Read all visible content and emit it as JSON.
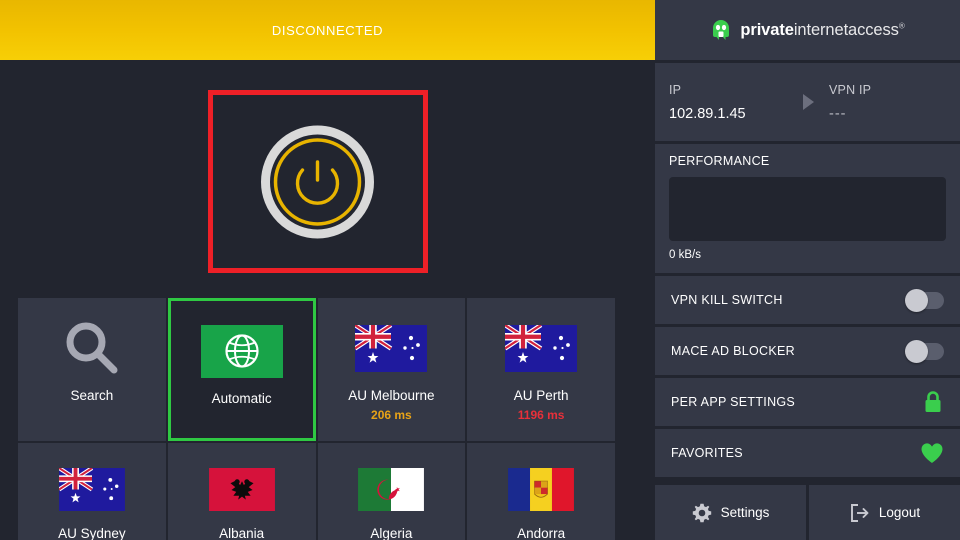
{
  "status_banner": {
    "label": "DISCONNECTED",
    "background_color": "#f2c200",
    "text_color": "#ffffff"
  },
  "power_button": {
    "name": "power-toggle",
    "state": "off",
    "outer_ring_color": "#d9d9d9",
    "inner_ring_color": "#e8b400",
    "glyph_color": "#e8b400",
    "highlight_border_color": "#ee2027"
  },
  "brand": {
    "bold_part": "private",
    "light_part": "internetaccess",
    "registered_mark": "®",
    "logo_color": "#3ace4d"
  },
  "ip_panel": {
    "ip_label": "IP",
    "ip_value": "102.89.1.45",
    "vpn_ip_label": "VPN IP",
    "vpn_ip_value": "---"
  },
  "performance": {
    "title": "PERFORMANCE",
    "rate": "0 kB/s"
  },
  "settings_rows": [
    {
      "label": "VPN KILL SWITCH",
      "control": "toggle",
      "state": "off"
    },
    {
      "label": "MACE AD BLOCKER",
      "control": "toggle",
      "state": "off"
    },
    {
      "label": "PER APP SETTINGS",
      "control": "lock-icon",
      "icon_color": "#3ace4d"
    },
    {
      "label": "FAVORITES",
      "control": "heart-icon",
      "icon_color": "#3ace4d"
    }
  ],
  "bottom_buttons": [
    {
      "label": "Settings",
      "icon": "gear-icon"
    },
    {
      "label": "Logout",
      "icon": "logout-icon"
    }
  ],
  "tiles": [
    {
      "label": "Search",
      "icon": "search-icon",
      "latency": "",
      "latency_color": "",
      "selected": false,
      "flag": "none"
    },
    {
      "label": "Automatic",
      "icon": "globe-icon",
      "latency": "",
      "latency_color": "",
      "selected": true,
      "flag": "none"
    },
    {
      "label": "AU Melbourne",
      "icon": "flag",
      "latency": "206 ms",
      "latency_color": "#e8a317",
      "selected": false,
      "flag": "australia"
    },
    {
      "label": "AU Perth",
      "icon": "flag",
      "latency": "1196 ms",
      "latency_color": "#e8303a",
      "selected": false,
      "flag": "australia"
    },
    {
      "label": "AU Sydney",
      "icon": "flag",
      "latency": "",
      "latency_color": "",
      "selected": false,
      "flag": "australia"
    },
    {
      "label": "Albania",
      "icon": "flag",
      "latency": "",
      "latency_color": "",
      "selected": false,
      "flag": "albania"
    },
    {
      "label": "Algeria",
      "icon": "flag",
      "latency": "",
      "latency_color": "",
      "selected": false,
      "flag": "algeria"
    },
    {
      "label": "Andorra",
      "icon": "flag",
      "latency": "",
      "latency_color": "",
      "selected": false,
      "flag": "andorra"
    }
  ],
  "colors": {
    "app_background": "#22252f",
    "panel_background": "#343846",
    "accent_green": "#3ace4d",
    "accent_yellow": "#f2c200",
    "highlight_red": "#ee2027"
  }
}
